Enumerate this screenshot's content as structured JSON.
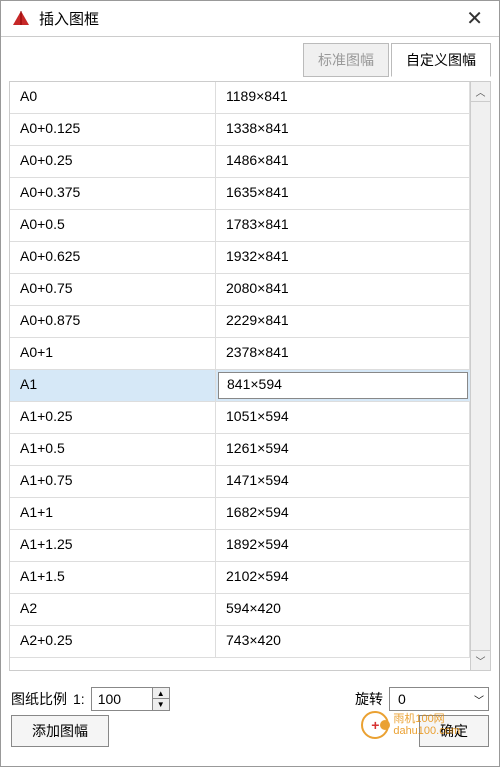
{
  "window": {
    "title": "插入图框"
  },
  "tabs": {
    "standard": "标准图幅",
    "custom": "自定义图幅"
  },
  "rows": [
    {
      "name": "A0",
      "size": "1189×841",
      "selected": false
    },
    {
      "name": "A0+0.125",
      "size": "1338×841",
      "selected": false
    },
    {
      "name": "A0+0.25",
      "size": "1486×841",
      "selected": false
    },
    {
      "name": "A0+0.375",
      "size": "1635×841",
      "selected": false
    },
    {
      "name": "A0+0.5",
      "size": "1783×841",
      "selected": false
    },
    {
      "name": "A0+0.625",
      "size": "1932×841",
      "selected": false
    },
    {
      "name": "A0+0.75",
      "size": "2080×841",
      "selected": false
    },
    {
      "name": "A0+0.875",
      "size": "2229×841",
      "selected": false
    },
    {
      "name": "A0+1",
      "size": "2378×841",
      "selected": false
    },
    {
      "name": "A1",
      "size": " 841×594",
      "selected": true
    },
    {
      "name": "A1+0.25",
      "size": "1051×594",
      "selected": false
    },
    {
      "name": "A1+0.5",
      "size": "1261×594",
      "selected": false
    },
    {
      "name": "A1+0.75",
      "size": "1471×594",
      "selected": false
    },
    {
      "name": "A1+1",
      "size": "1682×594",
      "selected": false
    },
    {
      "name": "A1+1.25",
      "size": "1892×594",
      "selected": false
    },
    {
      "name": "A1+1.5",
      "size": "2102×594",
      "selected": false
    },
    {
      "name": "A2",
      "size": "594×420",
      "selected": false
    },
    {
      "name": "A2+0.25",
      "size": "743×420",
      "selected": false
    }
  ],
  "footer": {
    "scale_label": "图纸比例",
    "scale_prefix": "1:",
    "scale_value": "100",
    "rotate_label": "旋转",
    "rotate_value": "0",
    "add_button": "添加图幅",
    "ok_button": "确定"
  },
  "watermark": {
    "line1": "雨机100网",
    "line2": "dahu100.com"
  }
}
